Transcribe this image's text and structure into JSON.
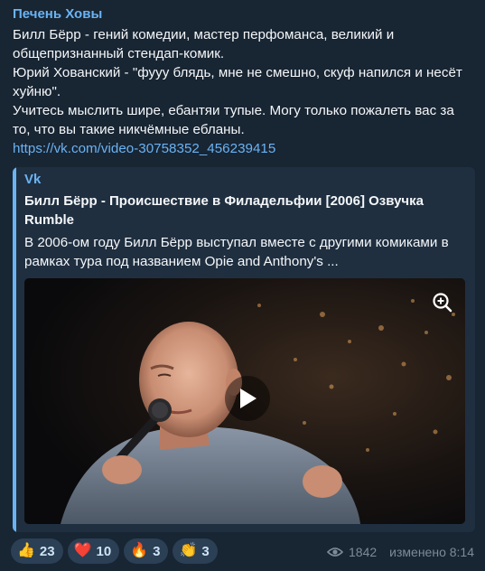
{
  "message": {
    "author": "Печень Ховы",
    "text": "Билл Бёрр - гений комедии, мастер перфоманса, великий и общепризнанный стендап-комик.\nЮрий Хованский - \"фууу блядь, мне не смешно, скуф напился и несёт хуйню\".\nУчитесь мыслить шире, ебантяи тупые. Могу только пожалеть вас за то, что вы такие никчёмные ебланы.",
    "link": "https://vk.com/video-30758352_456239415"
  },
  "preview": {
    "site": "Vk",
    "title": "Билл Бёрр - Происшествие в Филадельфии [2006] Озвучка Rumble",
    "description": "В 2006-ом году Билл Бёрр выступал вместе с другими комиками в рамках тура под названием Opie and Anthony's ...",
    "play_icon": "play-icon",
    "zoom_icon": "zoom-in-icon"
  },
  "reactions": [
    {
      "emoji": "👍",
      "icon": "thumbs-up-icon",
      "count": "23"
    },
    {
      "emoji": "❤️",
      "icon": "heart-icon",
      "count": "10"
    },
    {
      "emoji": "🔥",
      "icon": "fire-icon",
      "count": "3"
    },
    {
      "emoji": "👏",
      "icon": "clap-icon",
      "count": "3"
    }
  ],
  "meta": {
    "views": "1842",
    "edited": "изменено 8:14"
  },
  "colors": {
    "background": "#182533",
    "accent": "#6ab3f3",
    "preview_bg": "#1f2f40",
    "reaction_bg": "#2b3f55"
  }
}
